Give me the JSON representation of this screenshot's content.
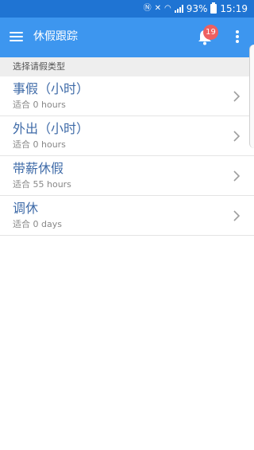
{
  "status_bar": {
    "battery": "93%",
    "time": "15:19",
    "icons": [
      "nfc-icon",
      "mute-icon",
      "wifi-icon",
      "signal-icon",
      "battery-icon"
    ]
  },
  "app_bar": {
    "title": "休假跟踪",
    "notification_count": "19"
  },
  "section": {
    "header": "选择请假类型"
  },
  "leave_types": [
    {
      "title": "事假（小时）",
      "subtitle": "适合 0 hours"
    },
    {
      "title": "外出（小时）",
      "subtitle": "适合 0 hours"
    },
    {
      "title": "带薪休假",
      "subtitle": "适合 55 hours"
    },
    {
      "title": "调休",
      "subtitle": "适合 0 days"
    }
  ],
  "colors": {
    "status_bar": "#1f74d3",
    "app_bar": "#3d96ef",
    "badge": "#ee6060",
    "item_title": "#3f6ba8"
  }
}
